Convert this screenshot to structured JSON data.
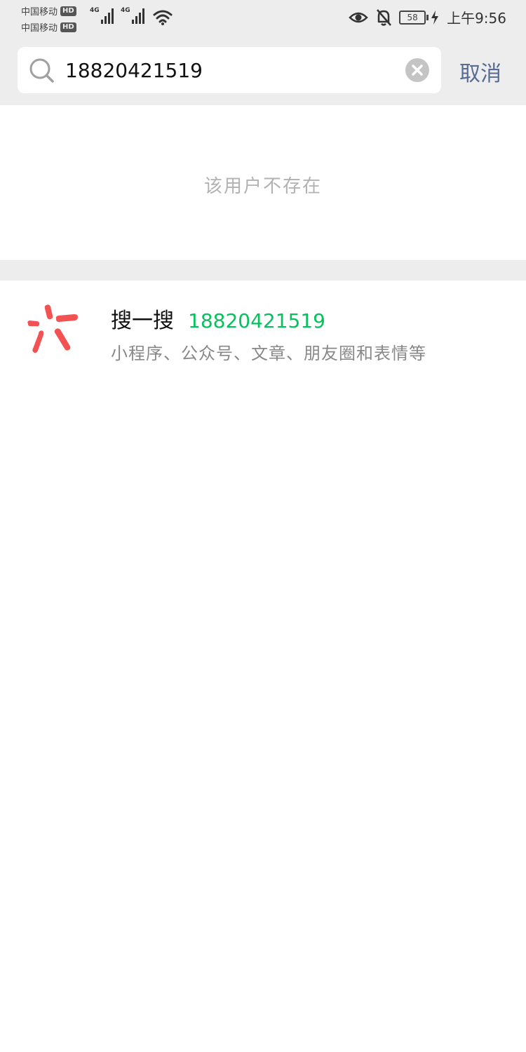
{
  "status_bar": {
    "carrier1": "中国移动",
    "carrier2": "中国移动",
    "hd": "HD",
    "network": "4G",
    "battery": "58",
    "time": "上午9:56"
  },
  "search": {
    "value": "18820421519",
    "cancel_label": "取消"
  },
  "result": {
    "not_exist": "该用户不存在"
  },
  "sousou": {
    "label": "搜一搜",
    "query": "18820421519",
    "description": "小程序、公众号、文章、朋友圈和表情等",
    "accent_color": "#07c160",
    "logo_color": "#f25252"
  },
  "colors": {
    "cancel": "#576b95",
    "background": "#ededed"
  }
}
